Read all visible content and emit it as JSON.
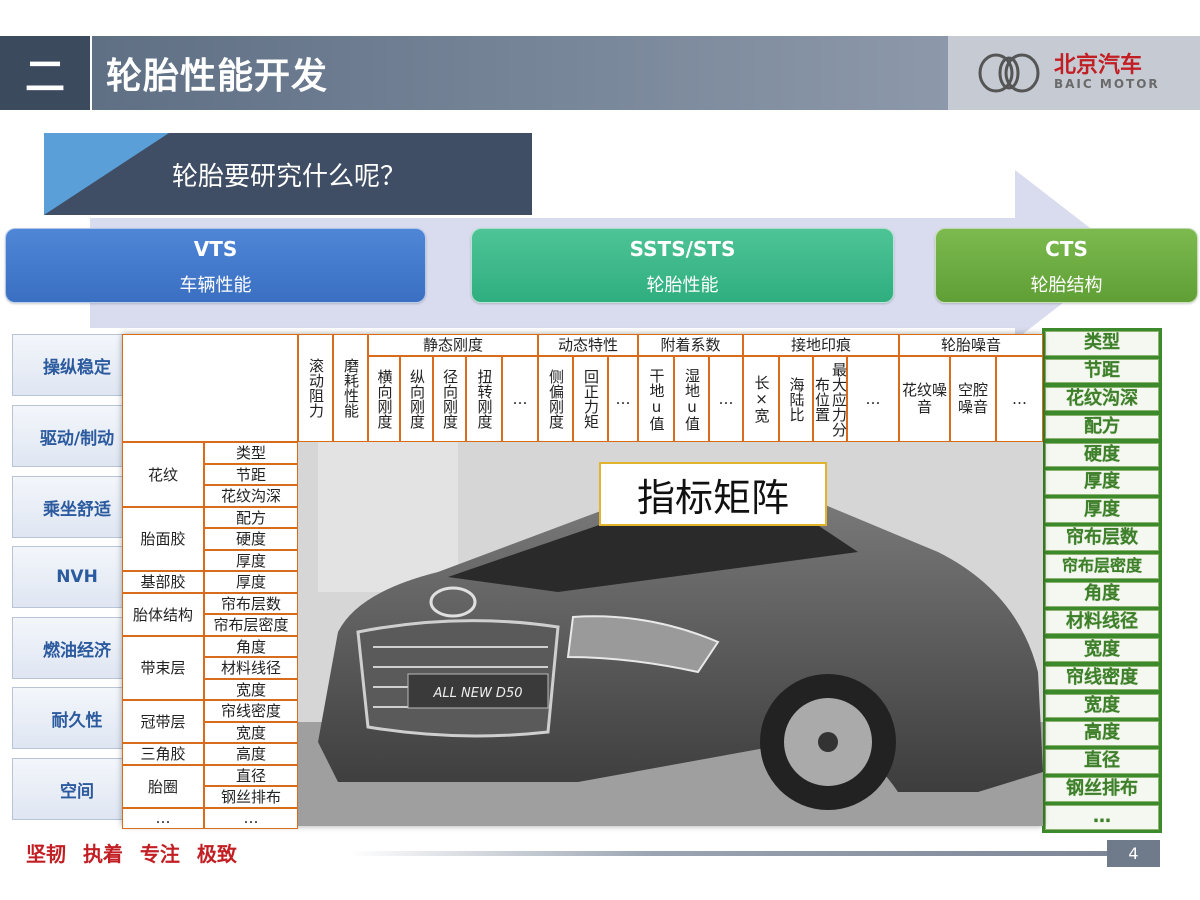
{
  "header": {
    "section_number": "二",
    "title": "轮胎性能开发",
    "logo_cn": "北京汽车",
    "logo_en": "BAIC MOTOR"
  },
  "question": "轮胎要研究什么呢？",
  "categories": [
    {
      "title": "VTS",
      "subtitle": "车辆性能"
    },
    {
      "title": "SSTS/STS",
      "subtitle": "轮胎性能"
    },
    {
      "title": "CTS",
      "subtitle": "轮胎结构"
    }
  ],
  "vts_items": [
    "操纵稳定",
    "驱动/制动",
    "乘坐舒适",
    "NVH",
    "燃油经济",
    "耐久性",
    "空间"
  ],
  "cts_items": [
    "类型",
    "节距",
    "花纹沟深",
    "配方",
    "硬度",
    "厚度",
    "厚度",
    "帘布层数",
    "帘布层密度",
    "角度",
    "材料线径",
    "宽度",
    "帘线密度",
    "宽度",
    "高度",
    "直径",
    "钢丝排布",
    "…"
  ],
  "matrix": {
    "groups": [
      {
        "label": "静态刚度"
      },
      {
        "label": "动态特性"
      },
      {
        "label": "附着系数"
      },
      {
        "label": "接地印痕"
      },
      {
        "label": "轮胎噪音"
      }
    ],
    "columns": [
      {
        "label": "滚动阻力"
      },
      {
        "label": "磨耗性能"
      },
      {
        "label": "横向刚度"
      },
      {
        "label": "纵向刚度"
      },
      {
        "label": "径向刚度"
      },
      {
        "label": "扭转刚度"
      },
      {
        "label": "…"
      },
      {
        "label": "侧偏刚度"
      },
      {
        "label": "回正力矩"
      },
      {
        "label": "…"
      },
      {
        "label": "干地u值"
      },
      {
        "label": "湿地u值"
      },
      {
        "label": "…"
      },
      {
        "label": "长×宽"
      },
      {
        "label": "海陆比"
      },
      {
        "label": "最大应力分布位置"
      },
      {
        "label": "…"
      },
      {
        "label": "花纹噪音"
      },
      {
        "label": "空腔噪音"
      },
      {
        "label": "…"
      }
    ],
    "row_groups": [
      {
        "label": "花纹",
        "items": [
          "类型",
          "节距",
          "花纹沟深"
        ]
      },
      {
        "label": "胎面胶",
        "items": [
          "配方",
          "硬度",
          "厚度"
        ]
      },
      {
        "label": "基部胶",
        "items": [
          "厚度"
        ]
      },
      {
        "label": "胎体结构",
        "items": [
          "帘布层数",
          "帘布层密度"
        ]
      },
      {
        "label": "带束层",
        "items": [
          "角度",
          "材料线径",
          "宽度"
        ]
      },
      {
        "label": "冠带层",
        "items": [
          "帘线密度",
          "宽度"
        ]
      },
      {
        "label": "三角胶",
        "items": [
          "高度"
        ]
      },
      {
        "label": "胎圈",
        "items": [
          "直径",
          "钢丝排布"
        ]
      },
      {
        "label": "…",
        "items": [
          "…"
        ]
      }
    ],
    "center_label": "指标矩阵",
    "car_badge": "ALL NEW D50"
  },
  "footer": {
    "slogan": "坚韧 执着 专注 极致",
    "page_number": "4"
  },
  "colors": {
    "header_dark": "#3c4a5e",
    "brand_red": "#c21f24",
    "vts_blue": "#3a6fc2",
    "ssts_green": "#2fae7f",
    "cts_green": "#5f9f35",
    "table_border": "#d96b1c"
  }
}
